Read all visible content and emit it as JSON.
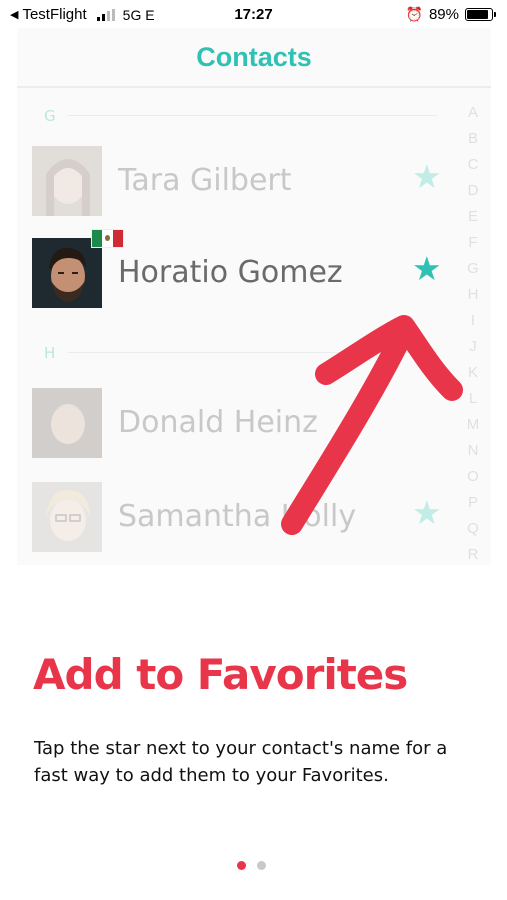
{
  "status_bar": {
    "back_app": "TestFlight",
    "network": "5G E",
    "time": "17:27",
    "battery": "89%",
    "battery_level": 0.89,
    "back_icon": "back-arrow-icon",
    "alarm_icon": "alarm-clock-icon"
  },
  "card": {
    "title": "Contacts",
    "sections": [
      {
        "letter": "G"
      },
      {
        "letter": "H"
      }
    ],
    "contacts": [
      {
        "name": "Tara Gilbert",
        "favorite": true,
        "highlighted": false
      },
      {
        "name": "Horatio Gomez",
        "favorite": true,
        "highlighted": true,
        "flag": "mexico-flag"
      },
      {
        "name": "Donald Heinz",
        "favorite": false,
        "highlighted": false
      },
      {
        "name": "Samantha Holly",
        "favorite": true,
        "highlighted": false
      }
    ],
    "star_glyph": "★",
    "index_letters": [
      "A",
      "B",
      "C",
      "D",
      "E",
      "F",
      "G",
      "H",
      "I",
      "J",
      "K",
      "L",
      "M",
      "N",
      "O",
      "P",
      "Q",
      "R"
    ]
  },
  "onboarding": {
    "headline": "Add to Favorites",
    "description": "Tap the star next to your contact's name for a fast way to add them to your Favorites.",
    "page_count": 2,
    "current_page": 1
  },
  "colors": {
    "accent": "#2fc1b3",
    "headline": "#e8354a",
    "arrow": "#e8354a"
  }
}
